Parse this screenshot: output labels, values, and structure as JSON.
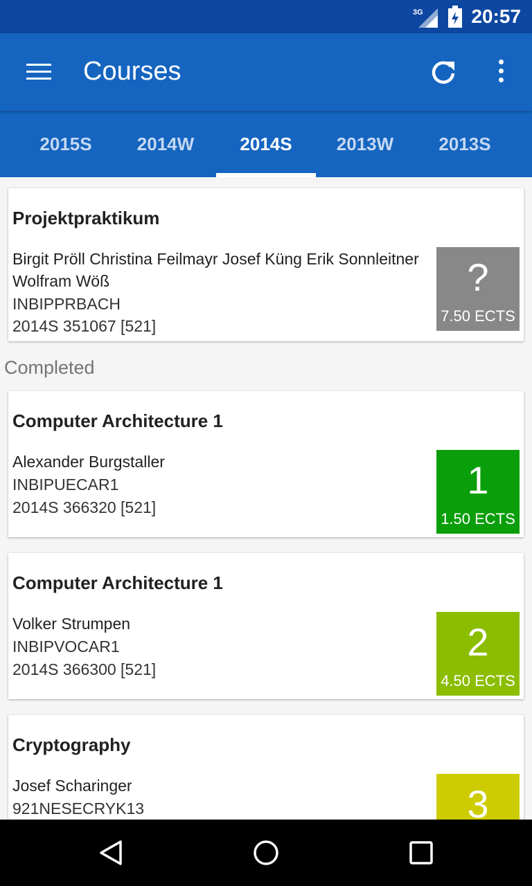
{
  "status": {
    "network": "3G",
    "time": "20:57"
  },
  "appbar": {
    "title": "Courses"
  },
  "tabs": [
    {
      "label": "2015S",
      "active": false
    },
    {
      "label": "2014W",
      "active": false
    },
    {
      "label": "2014S",
      "active": true
    },
    {
      "label": "2013W",
      "active": false
    },
    {
      "label": "2013S",
      "active": false
    }
  ],
  "courses": [
    {
      "title": "Projektpraktikum",
      "lecturers_line1": "Birgit Pröll Christina Feilmayr Josef Küng Erik Sonnleitner",
      "lecturers_line2": "Wolfram Wöß",
      "code": "INBIPPRBACH",
      "term": "2014S 351067 [521]",
      "grade": "?",
      "ects": "7.50 ECTS",
      "grade_color": "#888888"
    },
    {
      "title": "Computer Architecture 1",
      "lecturers_line1": "Alexander Burgstaller",
      "code": "INBIPUECAR1",
      "term": "2014S 366320 [521]",
      "grade": "1",
      "ects": "1.50 ECTS",
      "grade_color": "#0a9e0a"
    },
    {
      "title": "Computer Architecture 1",
      "lecturers_line1": "Volker Strumpen",
      "code": "INBIPVOCAR1",
      "term": "2014S 366300 [521]",
      "grade": "2",
      "ects": "4.50 ECTS",
      "grade_color": "#8bbd00"
    },
    {
      "title": "Cryptography",
      "lecturers_line1": "Josef Scharinger",
      "code": "921NESECRYK13",
      "grade": "3",
      "grade_color": "#cccc00"
    }
  ],
  "section": {
    "completed_label": "Completed"
  },
  "icons": {
    "menu": "menu-icon",
    "refresh": "refresh-icon",
    "overflow": "more-vert-icon",
    "back": "back-triangle-icon",
    "home": "home-circle-icon",
    "recents": "recents-square-icon"
  }
}
